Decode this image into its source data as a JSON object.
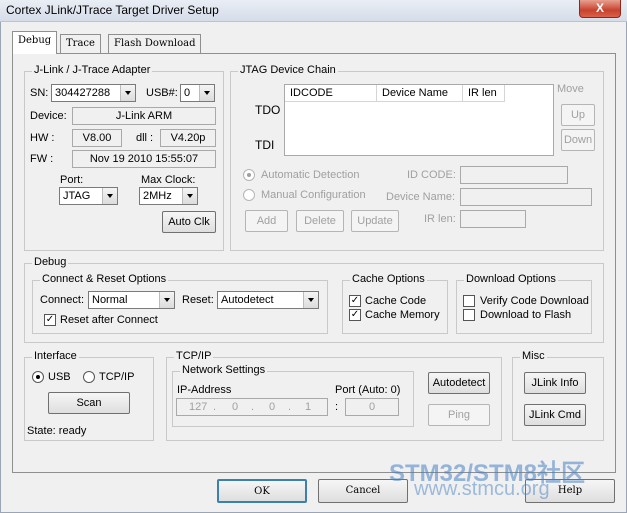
{
  "window": {
    "title": "Cortex JLink/JTrace Target Driver Setup",
    "close_label": "X"
  },
  "tabs": [
    {
      "label": "Debug"
    },
    {
      "label": "Trace"
    },
    {
      "label": "Flash Download"
    }
  ],
  "adapter": {
    "legend": "J-Link / J-Trace Adapter",
    "sn_label": "SN:",
    "sn_value": "304427288",
    "usb_label": "USB#:",
    "usb_value": "0",
    "device_label": "Device:",
    "device_value": "J-Link ARM",
    "hw_label": "HW :",
    "hw_value": "V8.00",
    "dll_label": "dll :",
    "dll_value": "V4.20p",
    "fw_label": "FW :",
    "fw_value": "Nov 19 2010 15:55:07",
    "port_label": "Port:",
    "port_value": "JTAG",
    "maxclock_label": "Max Clock:",
    "maxclock_value": "2MHz",
    "autoclk_label": "Auto Clk"
  },
  "jtag": {
    "legend": "JTAG Device Chain",
    "tdo_label": "TDO",
    "tdi_label": "TDI",
    "columns": [
      "IDCODE",
      "Device Name",
      "IR len"
    ],
    "move_label": "Move",
    "up_label": "Up",
    "down_label": "Down",
    "auto_detect_label": "Automatic Detection",
    "manual_config_label": "Manual Configuration",
    "idcode_label": "ID CODE:",
    "device_name_label": "Device Name:",
    "irlen_label": "IR len:",
    "add_label": "Add",
    "delete_label": "Delete",
    "update_label": "Update"
  },
  "debug": {
    "legend": "Debug",
    "connect_reset_legend": "Connect & Reset Options",
    "connect_label": "Connect:",
    "connect_value": "Normal",
    "reset_label": "Reset:",
    "reset_value": "Autodetect",
    "reset_after_connect_label": "Reset after Connect",
    "cache_legend": "Cache Options",
    "cache_code_label": "Cache Code",
    "cache_memory_label": "Cache Memory",
    "download_legend": "Download Options",
    "verify_label": "Verify Code Download",
    "download_flash_label": "Download to Flash"
  },
  "interface": {
    "legend": "Interface",
    "usb_label": "USB",
    "tcpip_label": "TCP/IP",
    "scan_label": "Scan",
    "state_label": "State: ready"
  },
  "tcpip": {
    "legend": "TCP/IP",
    "network_legend": "Network Settings",
    "ip_label": "IP-Address",
    "ip": [
      "127",
      "0",
      "0",
      "1"
    ],
    "port_label": "Port (Auto: 0)",
    "port_value": "0",
    "autodetect_label": "Autodetect",
    "ping_label": "Ping"
  },
  "misc": {
    "legend": "Misc",
    "jlink_info_label": "JLink Info",
    "jlink_cmd_label": "JLink Cmd"
  },
  "footer": {
    "ok_label": "OK",
    "cancel_label": "Cancel",
    "help_label": "Help"
  },
  "watermark": {
    "line1": "STM32/STM8社区",
    "line2": "www.stmcu.org"
  }
}
